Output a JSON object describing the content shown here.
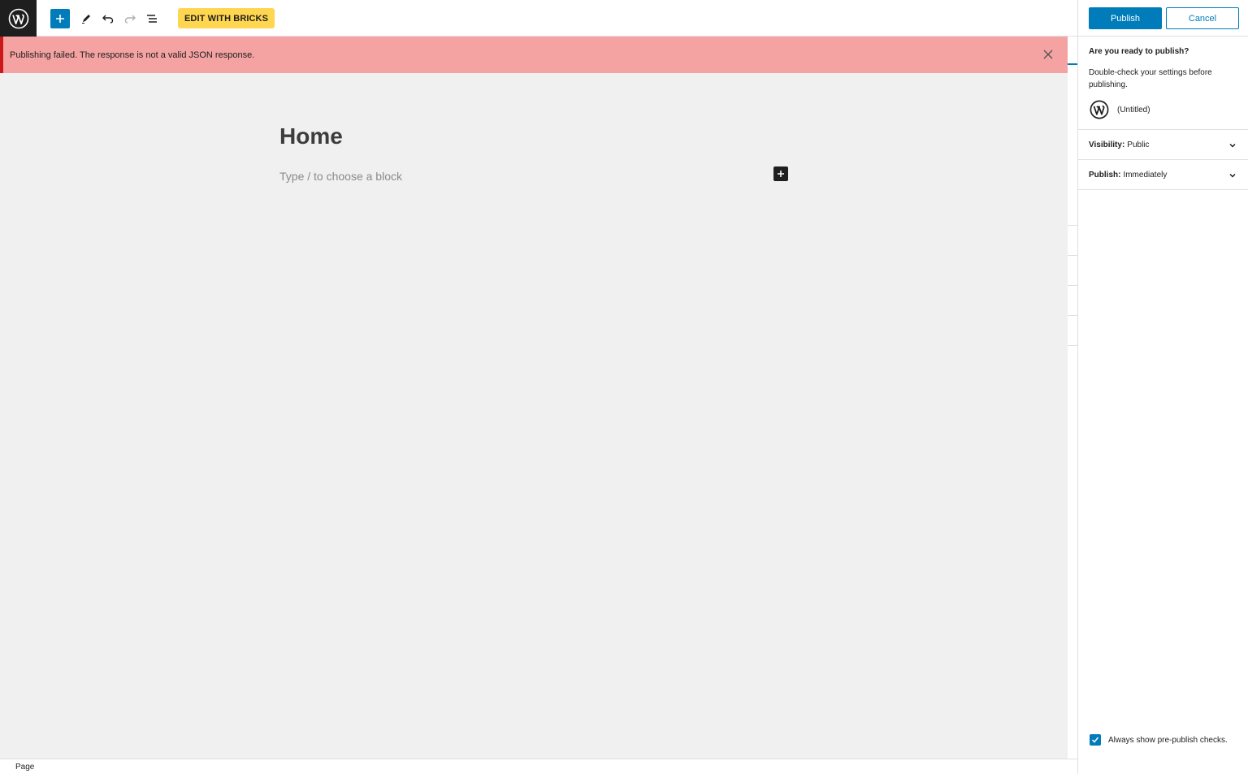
{
  "toolbar": {
    "wp_logo_icon": "wordpress-logo-icon",
    "add_block_icon": "plus-icon",
    "tools_icon": "pencil-icon",
    "undo_icon": "undo-icon",
    "redo_icon": "redo-icon",
    "list_view_icon": "list-view-icon",
    "bricks_label": "EDIT WITH BRICKS",
    "accent_color": "#007cba",
    "bricks_color": "#ffd64f"
  },
  "notice": {
    "text": "Publishing failed. The response is not a valid JSON response.",
    "close_icon": "close-icon",
    "background_color": "#f4a2a2",
    "border_color": "#cc1818"
  },
  "editor": {
    "title": "Home",
    "block_placeholder": "Type / to choose a block",
    "inline_add_icon": "plus-icon"
  },
  "footer": {
    "breadcrumb": "Page"
  },
  "prepublish": {
    "publish_label": "Publish",
    "cancel_label": "Cancel",
    "heading": "Are you ready to publish?",
    "description": "Double-check your settings before publishing.",
    "site_icon": "wordpress-logo-icon",
    "site_name": "(Untitled)",
    "visibility_label": "Visibility:",
    "visibility_value": "Public",
    "publish_time_label": "Publish:",
    "publish_time_value": "Immediately",
    "always_show_label": "Always show pre-publish checks.",
    "always_show_checked": true
  }
}
